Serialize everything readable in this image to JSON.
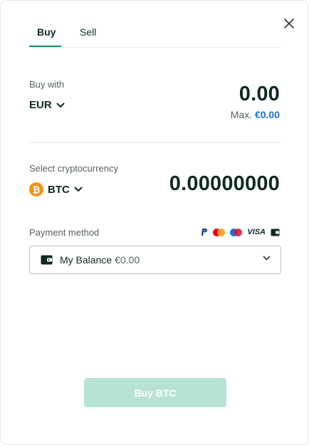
{
  "tabs": {
    "buy_label": "Buy",
    "sell_label": "Sell",
    "active": "Buy"
  },
  "close_icon": "close-icon",
  "buy_with": {
    "label": "Buy with",
    "currency": "EUR",
    "amount": "0.00",
    "max_prefix": "Max.",
    "max_value": "€0.00"
  },
  "crypto": {
    "label": "Select cryptocurrency",
    "currency": "BTC",
    "icon": "bitcoin-icon",
    "amount": "0.00000000"
  },
  "payment": {
    "label": "Payment method",
    "icons": [
      "paypal-icon",
      "mastercard-icon",
      "maestro-icon",
      "visa-icon",
      "wallet-icon"
    ],
    "visa_text": "VISA",
    "selected_name": "My Balance",
    "selected_balance": "€0.00"
  },
  "cta": {
    "label": "Buy BTC",
    "state": "disabled"
  },
  "colors": {
    "accent": "#1a8b6c",
    "cta_disabled": "#b7e4d2",
    "link_blue": "#1a73d9",
    "bitcoin_orange": "#f7931a"
  }
}
